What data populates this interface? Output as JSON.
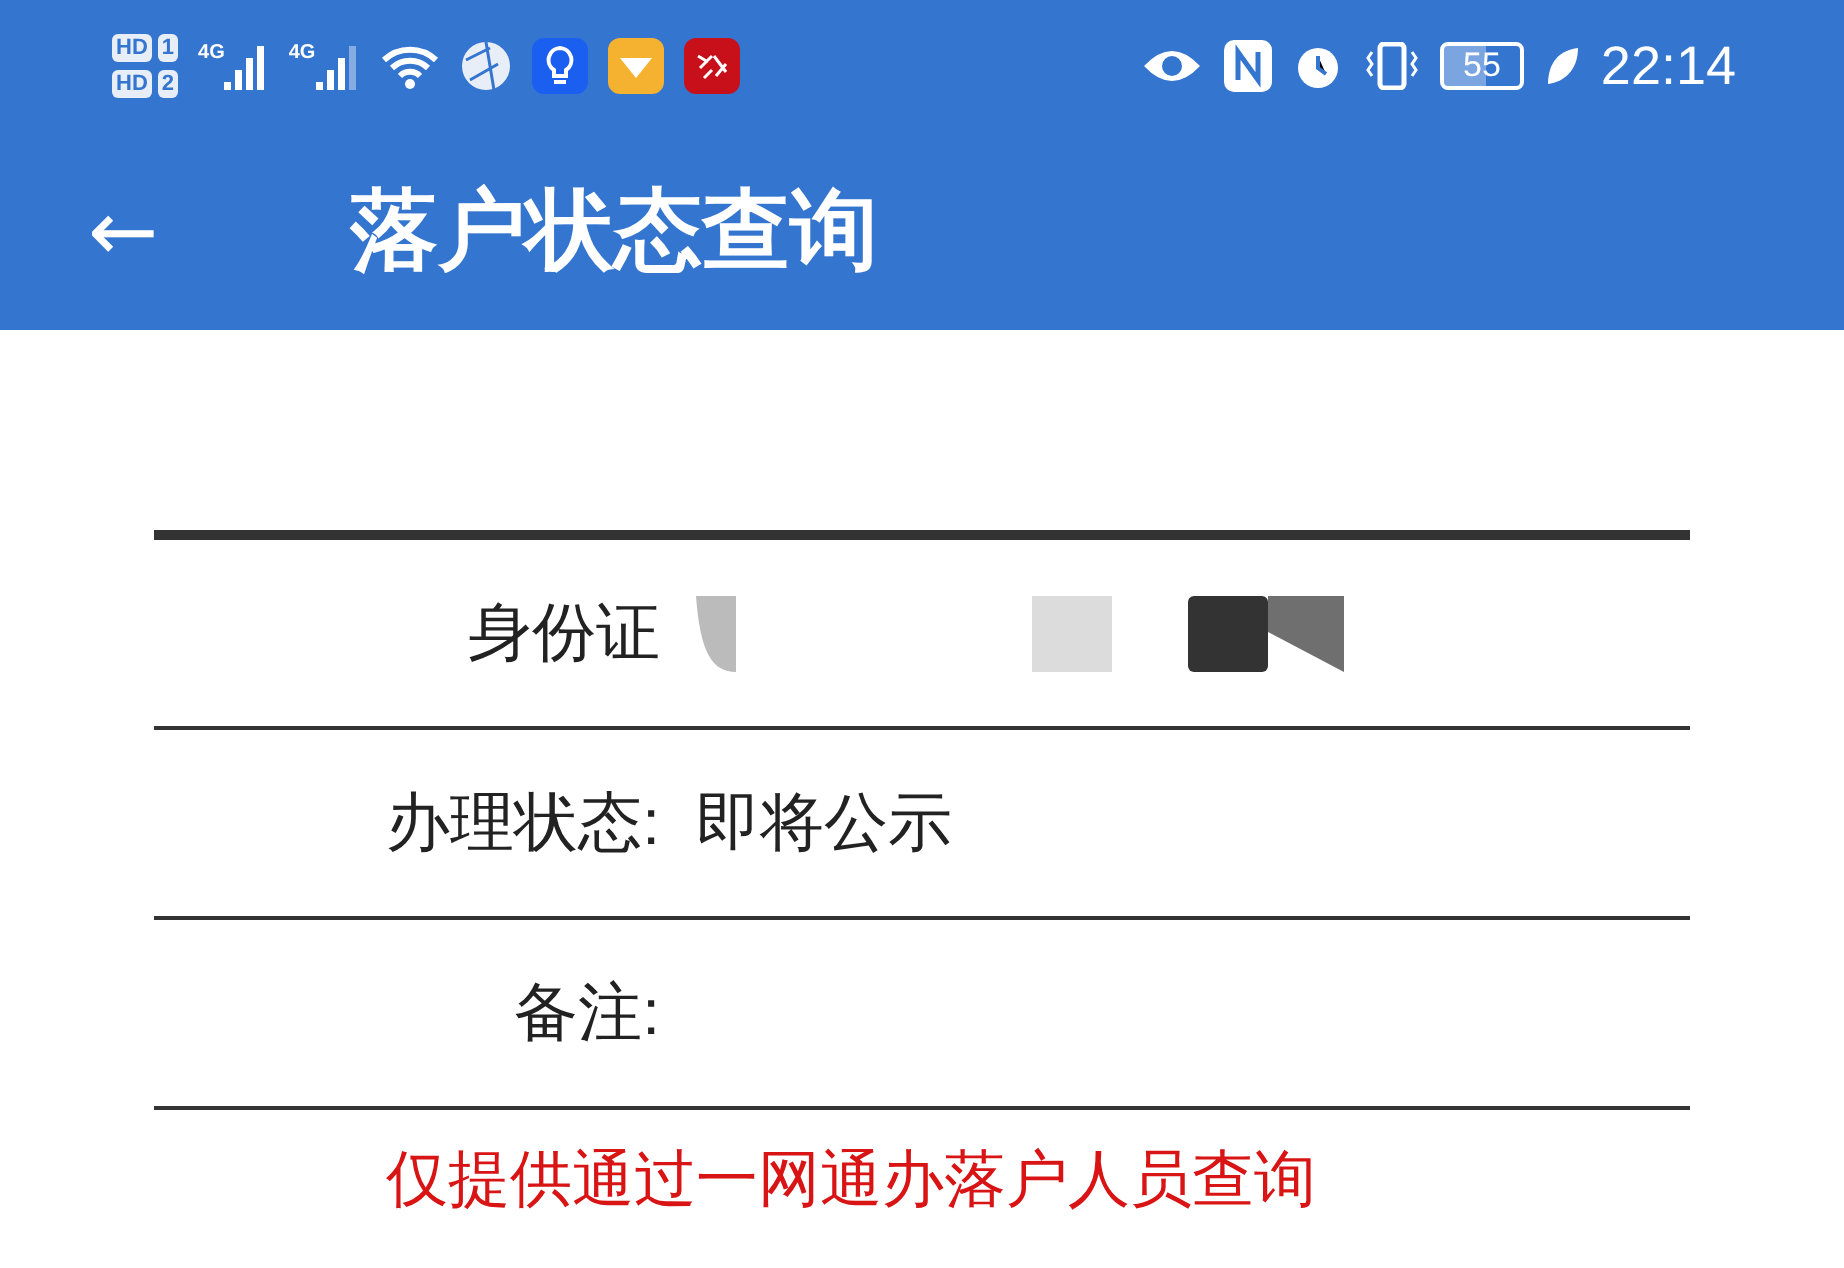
{
  "status_bar": {
    "sims": [
      {
        "badge": "HD",
        "slot": "1"
      },
      {
        "badge": "HD",
        "slot": "2"
      }
    ],
    "networks": [
      "4G",
      "4G"
    ],
    "battery": "55",
    "time": "22:14"
  },
  "toolbar": {
    "back": "←",
    "title": "落户状态查询"
  },
  "rows": [
    {
      "label": "身份证",
      "value_redacted": true
    },
    {
      "label": "办理状态:",
      "value": "即将公示"
    },
    {
      "label": "备注:"
    }
  ],
  "note": "仅提供通过一网通办落户人员查询"
}
